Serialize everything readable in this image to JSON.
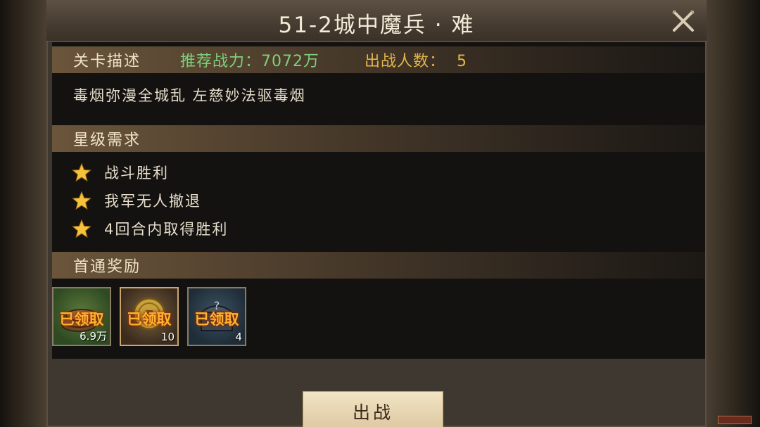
{
  "title": "51-2城中魔兵 · 难",
  "stage_info": {
    "header_label": "关卡描述",
    "power_label": "推荐战力：7072万",
    "count_label": "出战人数：",
    "count_value": "5",
    "description": "毒烟弥漫全城乱 左慈妙法驱毒烟"
  },
  "star_requirements": {
    "header_label": "星级需求",
    "items": [
      {
        "label": "战斗胜利"
      },
      {
        "label": "我军无人撤退"
      },
      {
        "label": "4回合内取得胜利"
      }
    ]
  },
  "first_clear_rewards": {
    "header_label": "首通奖励",
    "items": [
      {
        "status": "已领取",
        "quantity": "6.9万",
        "icon": "copper-coins-icon"
      },
      {
        "status": "已领取",
        "quantity": "10",
        "icon": "gold-coin-icon"
      },
      {
        "status": "已领取",
        "quantity": "4",
        "icon": "mystery-chest-icon"
      }
    ]
  },
  "fight_button_label": "出战",
  "colors": {
    "power": "#7fd07a",
    "count": "#e3b54a",
    "claimed": "#ffb22e",
    "star": "#f5c23a"
  }
}
